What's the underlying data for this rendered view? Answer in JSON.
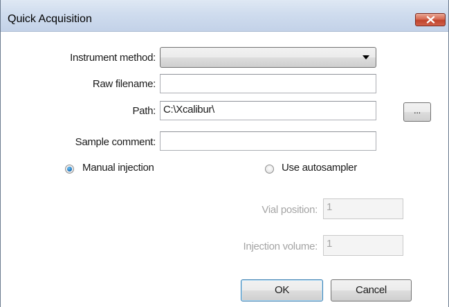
{
  "window": {
    "title": "Quick Acquisition"
  },
  "form": {
    "instrument_method": {
      "label": "Instrument method:",
      "value": ""
    },
    "raw_filename": {
      "label": "Raw filename:",
      "value": ""
    },
    "path": {
      "label": "Path:",
      "value": "C:\\Xcalibur\\",
      "browse_label": "..."
    },
    "sample_comment": {
      "label": "Sample comment:",
      "value": ""
    },
    "injection_mode": {
      "manual_label": "Manual injection",
      "autosampler_label": "Use autosampler",
      "selected": "manual"
    },
    "vial_position": {
      "label": "Vial position:",
      "value": "1",
      "enabled": false
    },
    "injection_volume": {
      "label": "Injection volume:",
      "value": "1",
      "enabled": false
    }
  },
  "buttons": {
    "ok_label": "OK",
    "cancel_label": "Cancel"
  },
  "icons": {
    "close": "close-icon",
    "dropdown": "chevron-down-icon"
  },
  "colors": {
    "titlebar": "#cfdcee",
    "close_button": "#c0432c",
    "radio_selected": "#1f78c1",
    "disabled_text": "#a4a4a4"
  }
}
